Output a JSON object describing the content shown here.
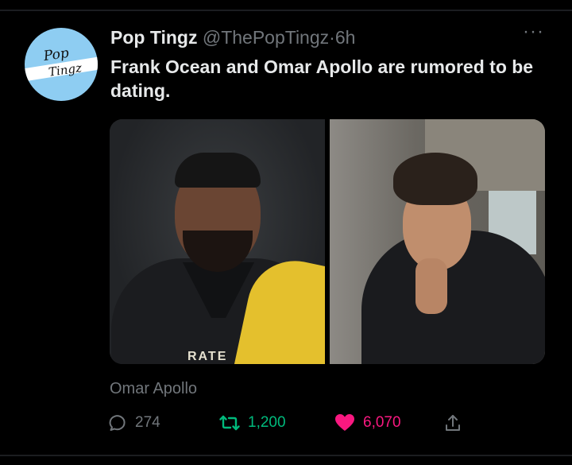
{
  "tweet": {
    "author_name": "Pop Tingz",
    "handle": "@ThePopTingz",
    "separator": "·",
    "time": "6h",
    "text": "Frank Ocean and Omar Apollo are rumored to be dating.",
    "caption": "Omar Apollo",
    "avatar_logo_top": "Pop",
    "avatar_logo_bottom": "Tingz",
    "image_text": "RATE"
  },
  "actions": {
    "reply_count": "274",
    "retweet_count": "1,200",
    "like_count": "6,070"
  },
  "colors": {
    "background": "#000000",
    "secondary_text": "#71767b",
    "retweet_active": "#00ba7c",
    "like_active": "#f91880",
    "avatar_bg": "#8ecdf2"
  },
  "icons": [
    "more-icon",
    "reply-icon",
    "retweet-icon",
    "heart-icon",
    "share-icon"
  ]
}
